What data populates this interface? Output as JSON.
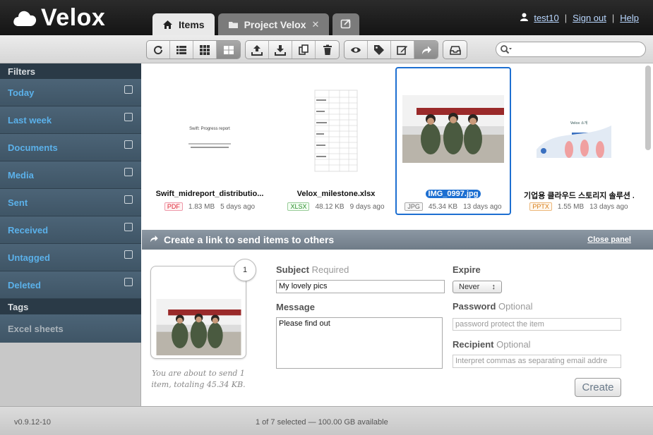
{
  "app": {
    "name": "Velox"
  },
  "tabs": [
    {
      "label": "Items"
    },
    {
      "label": "Project Velox"
    }
  ],
  "user": {
    "name": "test10",
    "signout": "Sign out",
    "help": "Help",
    "sep": "|"
  },
  "search": {
    "placeholder": ""
  },
  "sidebar": {
    "filters_label": "Filters",
    "filters": [
      {
        "label": "Today"
      },
      {
        "label": "Last week"
      },
      {
        "label": "Documents"
      },
      {
        "label": "Media"
      },
      {
        "label": "Sent"
      },
      {
        "label": "Received"
      },
      {
        "label": "Untagged"
      },
      {
        "label": "Deleted"
      }
    ],
    "tags_label": "Tags",
    "tags": [
      {
        "label": "Excel sheets"
      }
    ]
  },
  "items": [
    {
      "name": "Swift_midreport_distributio...",
      "type": "PDF",
      "size": "1.83 MB",
      "age": "5 days ago",
      "doc_title": "Swift: Progress report"
    },
    {
      "name": "Velox_milestone.xlsx",
      "type": "XLSX",
      "size": "48.12 KB",
      "age": "9 days ago"
    },
    {
      "name": "IMG_0997.jpg",
      "type": "JPG",
      "size": "45.34 KB",
      "age": "13 days ago",
      "selected": true
    },
    {
      "name": "기업용 클라우드 스토리지 솔루션 ...",
      "type": "PPTX",
      "size": "1.55 MB",
      "age": "13 days ago",
      "slide_title": "Velox 소개"
    }
  ],
  "panel": {
    "title": "Create a link to send items to others",
    "close": "Close panel",
    "count": "1",
    "note": "You are about to send 1 item, totaling 45.34 KB.",
    "subject_label": "Subject",
    "subject_hint": "Required",
    "subject_value": "My lovely pics",
    "message_label": "Message",
    "message_value": "Please find out",
    "expire_label": "Expire",
    "expire_value": "Never",
    "password_label": "Password",
    "password_hint": "Optional",
    "password_placeholder": "password protect the item",
    "recipient_label": "Recipient",
    "recipient_hint": "Optional",
    "recipient_placeholder": "Interpret commas as separating email addre",
    "create_label": "Create"
  },
  "footer": {
    "version": "v0.9.12-10",
    "status": "1 of 7 selected — 100.00 GB available"
  }
}
